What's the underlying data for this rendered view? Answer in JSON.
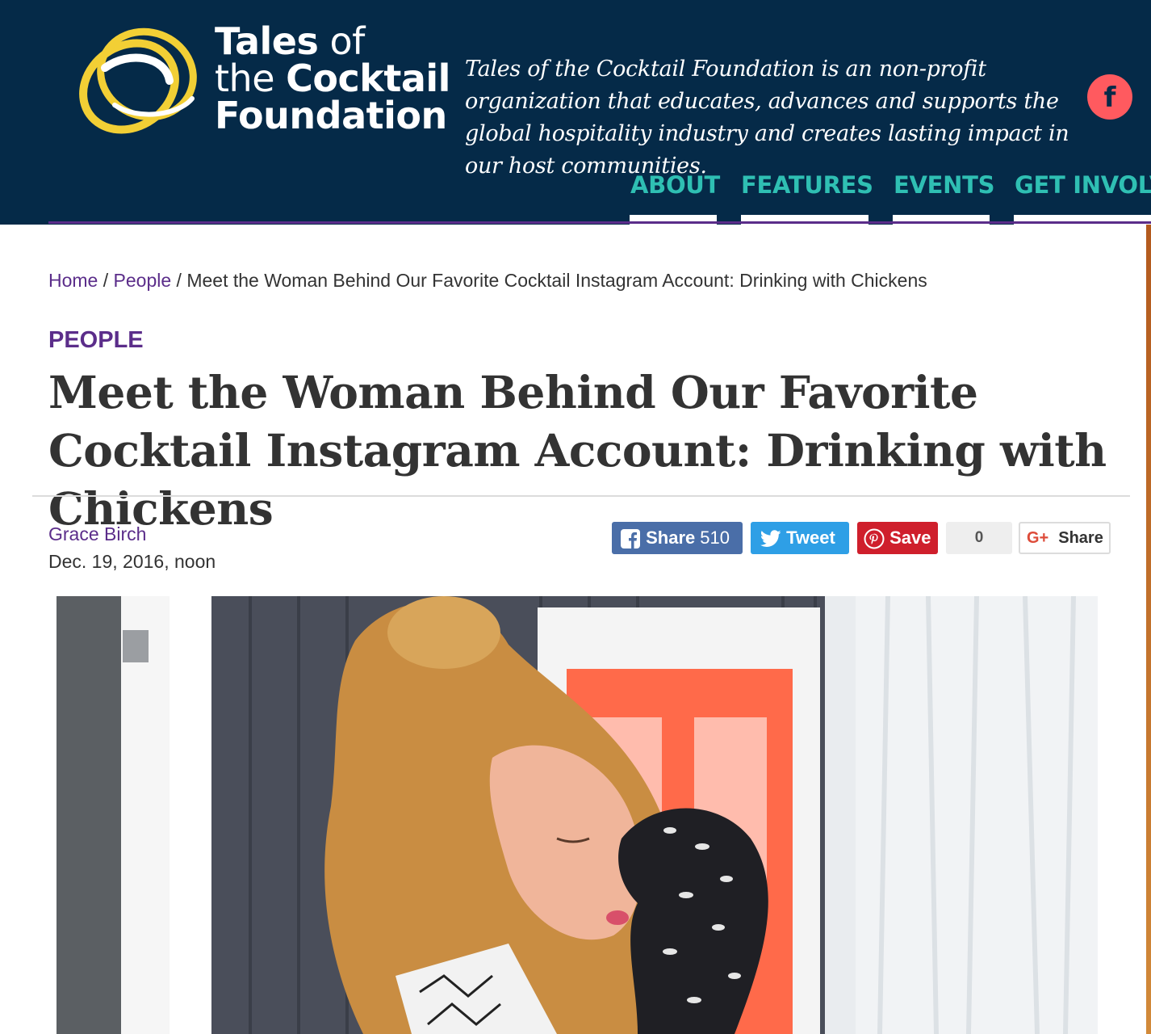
{
  "header": {
    "logo_alt": "Tales of the Cocktail Foundation logo",
    "logo_line1_bold": "Tales",
    "logo_line1_rest": " of",
    "logo_line2_pre": "the ",
    "logo_line2_bold": "Cocktail",
    "logo_line3": "Foundation",
    "tagline": "Tales of the Cocktail Foundation is an non-profit organization that educates, advances and supports the global hospitality industry and creates lasting impact in our host communities.",
    "facebook_icon_letter": "f"
  },
  "nav": {
    "items": [
      "ABOUT",
      "FEATURES",
      "EVENTS",
      "GET INVOLV"
    ]
  },
  "breadcrumb": {
    "home": "Home",
    "sep": " / ",
    "section": "People",
    "current": "Meet the Woman Behind Our Favorite Cocktail Instagram Account: Drinking with Chickens"
  },
  "article": {
    "category": "PEOPLE",
    "title": "Meet the Woman Behind Our Favorite Cocktail Instagram Account: Drinking with Chickens",
    "author": "Grace Birch",
    "date": "Dec. 19, 2016, noon",
    "hero_alt": "Woman kissing a black and white crested chicken"
  },
  "share": {
    "facebook_label": "Share",
    "facebook_count": "510",
    "twitter_label": "Tweet",
    "pinterest_label": "Save",
    "pinterest_count": "0",
    "gplus_icon": "G+",
    "gplus_label": "Share"
  },
  "colors": {
    "header_bg": "#052a48",
    "nav_text": "#2fbfb3",
    "accent_purple": "#5b2d8a",
    "logo_yellow": "#f2cf35",
    "facebook_blue": "#4a6ea8",
    "twitter_blue": "#2e9fe6",
    "pinterest_red": "#cf1f2c"
  }
}
